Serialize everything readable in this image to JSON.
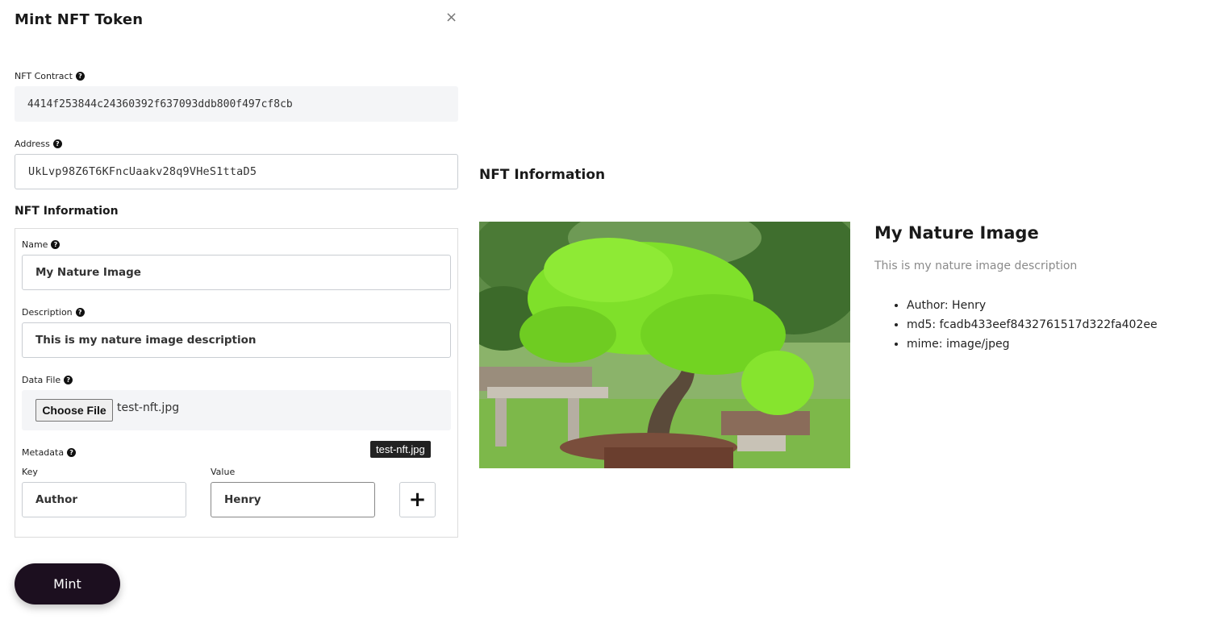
{
  "modal": {
    "title": "Mint NFT Token",
    "close_glyph": "×"
  },
  "contract": {
    "label": "NFT Contract",
    "value": "4414f253844c24360392f637093ddb800f497cf8cb"
  },
  "address": {
    "label": "Address",
    "value": "UkLvp98Z6T6KFncUaakv28q9VHeS1ttaD5"
  },
  "nft_info": {
    "heading": "NFT Information",
    "name": {
      "label": "Name",
      "value": "My Nature Image"
    },
    "description": {
      "label": "Description",
      "value": "This is my nature image description"
    },
    "data_file": {
      "label": "Data File",
      "button_label": "Choose File",
      "file_name": "test-nft.jpg",
      "tooltip": "test-nft.jpg"
    },
    "metadata": {
      "label": "Metadata",
      "key_label": "Key",
      "value_label": "Value",
      "key_value": "Author",
      "value_value": "Henry",
      "add_glyph": "+"
    }
  },
  "mint_button": {
    "label": "Mint"
  },
  "preview": {
    "heading": "NFT Information",
    "title": "My Nature Image",
    "description": "This is my nature image description",
    "metadata_items": [
      "Author: Henry",
      "md5: fcadb433eef8432761517d322fa402ee",
      "mime: image/jpeg"
    ]
  },
  "icons": {
    "help": "question-circle-icon",
    "close": "close-icon",
    "add": "plus-icon"
  },
  "colors": {
    "mint_button_bg": "#1c0f1f",
    "readonly_bg": "#f4f5f7",
    "muted_text": "#8a8a8a"
  }
}
